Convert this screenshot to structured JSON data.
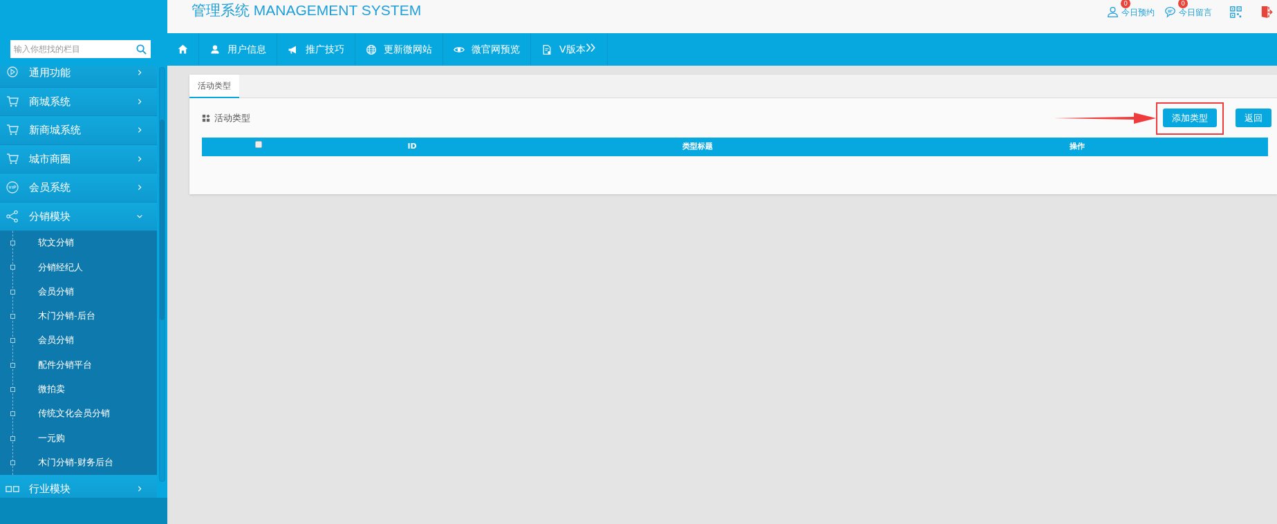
{
  "header": {
    "title": "管理系统 MANAGEMENT SYSTEM",
    "links": [
      {
        "label": "今日预约",
        "badge": "0"
      },
      {
        "label": "今日留言",
        "badge": "0"
      }
    ]
  },
  "sidebar": {
    "search": {
      "placeholder": "输入你想找的栏目"
    },
    "items": [
      {
        "label": "通用功能",
        "expanded": false
      },
      {
        "label": "商城系统",
        "expanded": false
      },
      {
        "label": "新商城系统",
        "expanded": false
      },
      {
        "label": "城市商圈",
        "expanded": false
      },
      {
        "label": "会员系统",
        "expanded": false
      },
      {
        "label": "分销模块",
        "expanded": true,
        "children": [
          {
            "label": "软文分销"
          },
          {
            "label": "分销经纪人"
          },
          {
            "label": "会员分销"
          },
          {
            "label": "木门分销-后台"
          },
          {
            "label": "会员分销"
          },
          {
            "label": "配件分销平台"
          },
          {
            "label": "微拍卖"
          },
          {
            "label": "传统文化会员分销"
          },
          {
            "label": "一元购"
          },
          {
            "label": "木门分销-财务后台"
          }
        ]
      },
      {
        "label": "行业模块",
        "expanded": false
      }
    ]
  },
  "nav": {
    "items": [
      {
        "label": "用户信息"
      },
      {
        "label": "推广技巧"
      },
      {
        "label": "更新微网站"
      },
      {
        "label": "微官网预览"
      },
      {
        "label": "V版本"
      }
    ]
  },
  "page": {
    "tabs": [
      {
        "label": "活动类型",
        "selected": true
      }
    ],
    "panel_title": "活动类型",
    "buttons": [
      {
        "label": "添加类型",
        "highlighted": true
      },
      {
        "label": "返回",
        "highlighted": false
      }
    ],
    "table": {
      "select_all": {
        "checked": false
      },
      "columns": [
        "ID",
        "类型标题",
        "操作"
      ]
    }
  }
}
